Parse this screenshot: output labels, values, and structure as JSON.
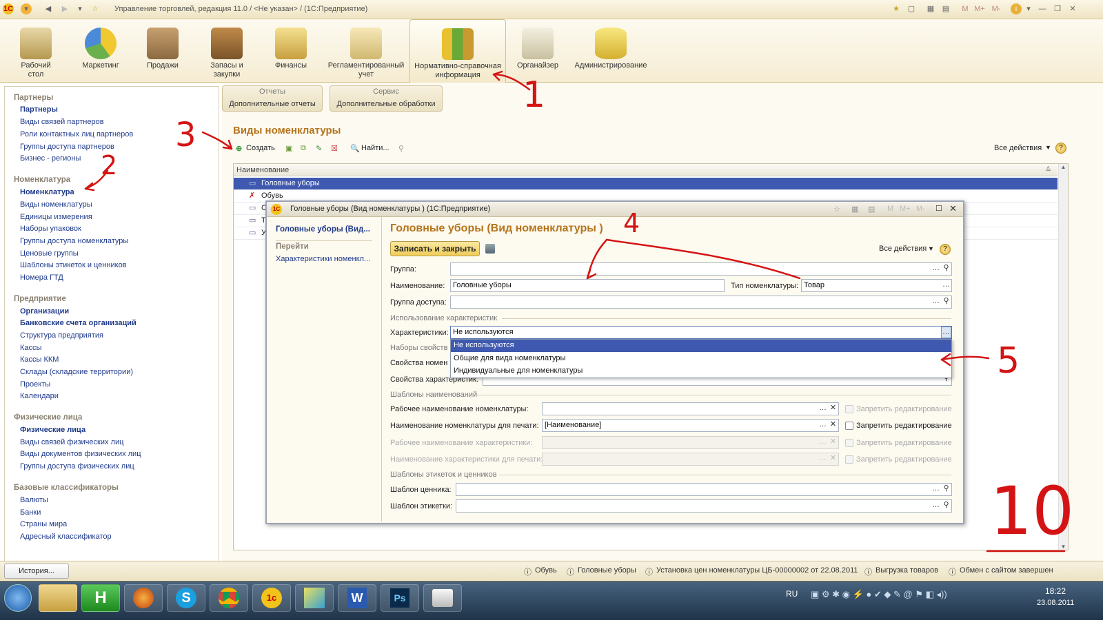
{
  "window": {
    "title": "Управление торговлей, редакция 11.0 / <Не указан> / (1С:Предприятие)",
    "right_buttons": [
      "M",
      "M+",
      "M-"
    ]
  },
  "sections": [
    {
      "label": "Рабочий стол",
      "icon": "desk-icon"
    },
    {
      "label": "Маркетинг",
      "icon": "pie-chart-icon"
    },
    {
      "label": "Продажи",
      "icon": "truck-icon"
    },
    {
      "label": "Запасы и закупки",
      "icon": "boxes-icon"
    },
    {
      "label": "Финансы",
      "icon": "coins-icon"
    },
    {
      "label": "Регламентированный учет",
      "icon": "ledger-icon"
    },
    {
      "label": "Нормативно-справочная информация",
      "icon": "folders-icon"
    },
    {
      "label": "Органайзер",
      "icon": "clipboard-icon"
    },
    {
      "label": "Администрирование",
      "icon": "database-icon"
    }
  ],
  "nav": [
    {
      "group": "Партнеры",
      "items": [
        {
          "label": "Партнеры",
          "bold": true
        },
        {
          "label": "Виды связей партнеров"
        },
        {
          "label": "Роли контактных лиц партнеров"
        },
        {
          "label": "Группы доступа партнеров"
        },
        {
          "label": "Бизнес - регионы"
        }
      ]
    },
    {
      "group": "Номенклатура",
      "items": [
        {
          "label": "Номенклатура",
          "bold": true
        },
        {
          "label": "Виды номенклатуры"
        },
        {
          "label": "Единицы измерения"
        },
        {
          "label": "Наборы упаковок"
        },
        {
          "label": "Группы доступа номенклатуры"
        },
        {
          "label": "Ценовые группы"
        },
        {
          "label": "Шаблоны этикеток и ценников"
        },
        {
          "label": "Номера ГТД"
        }
      ]
    },
    {
      "group": "Предприятие",
      "items": [
        {
          "label": "Организации",
          "bold": true
        },
        {
          "label": "Банковские счета организаций",
          "bold": true
        },
        {
          "label": "Структура предприятия"
        },
        {
          "label": "Кассы"
        },
        {
          "label": "Кассы ККМ"
        },
        {
          "label": "Склады (складские территории)"
        },
        {
          "label": "Проекты"
        },
        {
          "label": "Календари"
        }
      ]
    },
    {
      "group": "Физические лица",
      "items": [
        {
          "label": "Физические лица",
          "bold": true
        },
        {
          "label": "Виды связей физических лиц"
        },
        {
          "label": "Виды документов физических лиц"
        },
        {
          "label": "Группы доступа физических лиц"
        }
      ]
    },
    {
      "group": "Базовые классификаторы",
      "items": [
        {
          "label": "Валюты"
        },
        {
          "label": "Банки"
        },
        {
          "label": "Страны мира"
        },
        {
          "label": "Адресный классификатор"
        }
      ]
    }
  ],
  "panel_tabs": [
    {
      "header": "Отчеты",
      "sub": "Дополнительные отчеты"
    },
    {
      "header": "Сервис",
      "sub": "Дополнительные обработки"
    }
  ],
  "list": {
    "title": "Виды номенклатуры",
    "create_label": "Создать",
    "find_label": "Найти...",
    "all_actions": "Все действия",
    "column_header": "Наименование",
    "rows": [
      {
        "text": "Головные уборы",
        "selected": true,
        "marked": false
      },
      {
        "text": "Обувь",
        "selected": false,
        "marked": true
      },
      {
        "text": "С",
        "selected": false,
        "marked": false
      },
      {
        "text": "Т",
        "selected": false,
        "marked": false
      },
      {
        "text": "У",
        "selected": false,
        "marked": false
      }
    ]
  },
  "dialog": {
    "window_title": "Головные уборы (Вид номенклатуры ) (1С:Предприятие)",
    "right_buttons": [
      "M",
      "M+",
      "M-"
    ],
    "nav_current": "Головные уборы (Вид...",
    "nav_goto": "Перейти",
    "nav_link": "Характеристики номенкл...",
    "title": "Головные уборы (Вид номенклатуры )",
    "save_close": "Записать и закрыть",
    "all_actions": "Все действия",
    "group_label": "Группа:",
    "group_value": "",
    "name_label": "Наименование:",
    "name_value": "Головные уборы",
    "type_label": "Тип номенклатуры:",
    "type_value": "Товар",
    "access_label": "Группа доступа:",
    "access_value": "",
    "sec_characteristics": "Использование характеристик",
    "char_label": "Характеристики:",
    "char_value": "Не используются",
    "sec_props": "Наборы свойств",
    "props_nom_label": "Свойства номен",
    "props_char_label": "Свойства характеристик:",
    "dropdown_options": [
      "Не используются",
      "Общие для вида номенклатуры",
      "Индивидуальные для номенклатуры"
    ],
    "sec_name_templates": "Шаблоны наименований",
    "work_name_label": "Рабочее наименование номенклатуры:",
    "work_name_value": "",
    "print_name_label": "Наименование номенклатуры для печати:",
    "print_name_value": "[Наименование]",
    "work_char_label": "Рабочее наименование характеристики:",
    "print_char_label": "Наименование характеристики для печати:",
    "forbid_edit": "Запретить редактирование",
    "sec_labels": "Шаблоны этикеток и ценников",
    "price_tag_label": "Шаблон ценника:",
    "price_tag_value": "",
    "label_tpl_label": "Шаблон этикетки:",
    "label_tpl_value": ""
  },
  "statusbar": {
    "history": "История...",
    "items": [
      "Обувь",
      "Головные уборы",
      "Установка цен номенклатуры ЦБ-00000002 от 22.08.2011",
      "Выгрузка товаров",
      "Обмен с сайтом завершен"
    ]
  },
  "taskbar": {
    "lang": "RU",
    "time": "18:22",
    "date": "23.08.2011",
    "apps": [
      "explorer-icon",
      "1c-h-icon",
      "firefox-icon",
      "skype-icon",
      "chrome-icon",
      "1c-icon",
      "vector-icon",
      "word-icon",
      "photoshop-icon",
      "screenshot-icon"
    ]
  },
  "annotations": {
    "n1": "1",
    "n2": "2",
    "n3": "3",
    "n4": "4",
    "n5": "5",
    "n10": "10"
  },
  "colors": {
    "accent_title": "#b5741b",
    "link": "#1f3a8a",
    "selection": "#3f59b0",
    "annotation": "#d41414"
  }
}
